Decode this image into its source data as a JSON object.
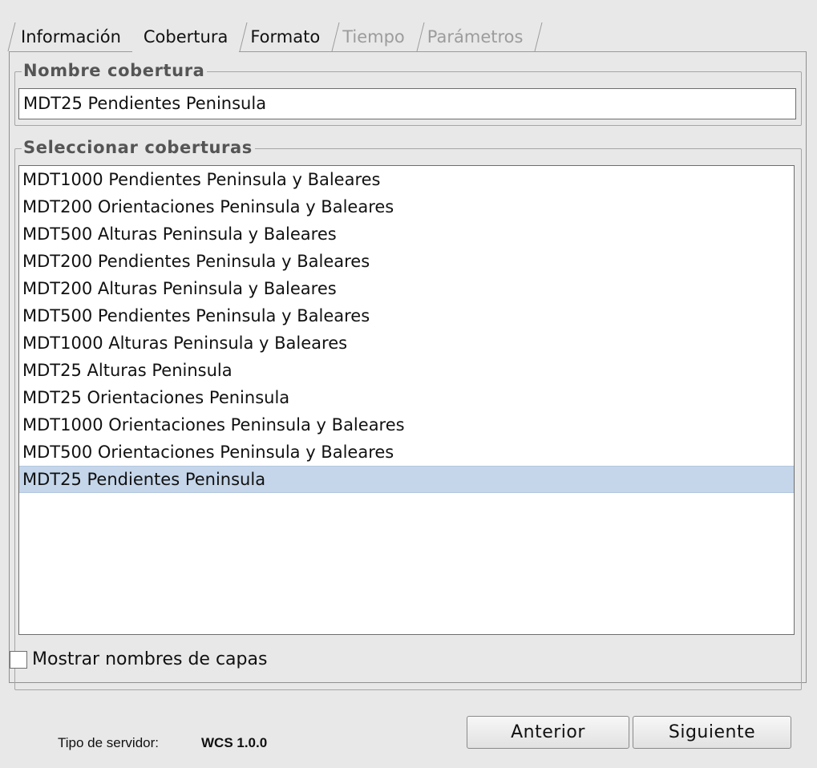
{
  "tabs": [
    {
      "label": "Información",
      "state": "normal"
    },
    {
      "label": "Cobertura",
      "state": "active"
    },
    {
      "label": "Formato",
      "state": "normal"
    },
    {
      "label": "Tiempo",
      "state": "disabled"
    },
    {
      "label": "Parámetros",
      "state": "disabled"
    }
  ],
  "coverage_name": {
    "title": "Nombre cobertura",
    "value": "MDT25 Pendientes Peninsula"
  },
  "select_coverages": {
    "title": "Seleccionar coberturas",
    "items": [
      "MDT1000 Pendientes Peninsula y Baleares",
      "MDT200 Orientaciones Peninsula y Baleares",
      "MDT500 Alturas Peninsula y Baleares",
      "MDT200 Pendientes Peninsula y Baleares",
      "MDT200 Alturas Peninsula y Baleares",
      "MDT500 Pendientes Peninsula y Baleares",
      "MDT1000 Alturas Peninsula y Baleares",
      "MDT25 Alturas Peninsula",
      "MDT25 Orientaciones Peninsula",
      "MDT1000 Orientaciones Peninsula y Baleares",
      "MDT500 Orientaciones Peninsula y Baleares",
      "MDT25 Pendientes Peninsula"
    ],
    "selected_item": "MDT25 Pendientes Peninsula"
  },
  "show_layer_names": {
    "label": "Mostrar nombres de capas",
    "checked": false
  },
  "footer": {
    "server_type_label": "Tipo de servidor:",
    "server_type_value": "WCS 1.0.0",
    "prev_button": "Anterior",
    "next_button": "Siguiente"
  },
  "colors": {
    "background": "#e8e8e8",
    "selection": "#c5d6ea",
    "disabled_text": "#9c9c9c"
  }
}
